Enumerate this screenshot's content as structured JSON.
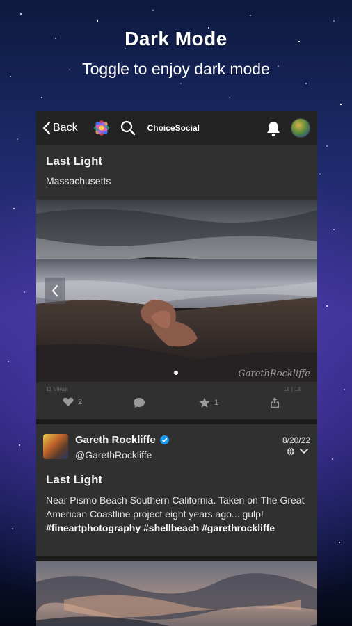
{
  "promo": {
    "title": "Dark Mode",
    "subtitle": "Toggle to enjoy dark mode"
  },
  "topbar": {
    "back_label": "Back",
    "brand": "ChoiceSocial",
    "icons": [
      "chevron-left-icon",
      "app-logo-icon",
      "search-icon",
      "bell-icon",
      "avatar"
    ]
  },
  "post1": {
    "title": "Last Light",
    "location": "Massachusetts",
    "views": "11 Views",
    "image_counter": "18 | 18",
    "likes": "2",
    "stars": "1",
    "signature": "GarethRockliffe"
  },
  "post2": {
    "author_name": "Gareth Rockliffe",
    "handle": "@GarethRockliffe",
    "date": "8/20/22",
    "title": "Last Light",
    "body_text": "Near Pismo Beach Southern California. Taken on The Great American Coastline project eight years ago... gulp!",
    "hashtags": [
      "#fineartphotography",
      "#shellbeach",
      "#garethrockliffe"
    ]
  },
  "colors": {
    "card_bg": "#303031",
    "bar_bg": "#232324",
    "verified": "#1d9bf0",
    "muted_icon": "#9a9a9a"
  }
}
